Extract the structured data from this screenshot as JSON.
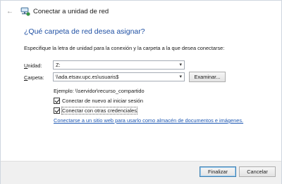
{
  "titlebar": {
    "back_icon": "back-arrow-icon",
    "network_icon": "network-drive-icon",
    "title": "Conectar a unidad de red"
  },
  "heading": "¿Qué carpeta de red desea asignar?",
  "instructions": "Especifique la letra de unidad para la conexión y la carpeta a la que desea conectarse:",
  "drive": {
    "label_prefix": "",
    "label_accel": "U",
    "label_rest": "nidad:",
    "value": "Z:"
  },
  "folder": {
    "label_prefix": "",
    "label_accel": "C",
    "label_rest": "arpeta:",
    "value": "\\\\ada.etsav.upc.es\\usuaris$",
    "browse_label": "Examinar..."
  },
  "example": "Ejemplo: \\\\servidor\\recurso_compartido",
  "options": {
    "reconnect": {
      "label": "Conectar de nuevo al iniciar sesión",
      "checked": true
    },
    "credentials": {
      "label": "Conectar con otras credenciales",
      "checked": true
    }
  },
  "link_text": "Conectarse a un sitio web para usarlo como almacén de documentos e imágenes.",
  "buttons": {
    "finish": "Finalizar",
    "cancel": "Cancelar"
  },
  "colors": {
    "heading": "#1e4fa3",
    "link": "#1e58b3",
    "footer": "#f0f0f0"
  }
}
